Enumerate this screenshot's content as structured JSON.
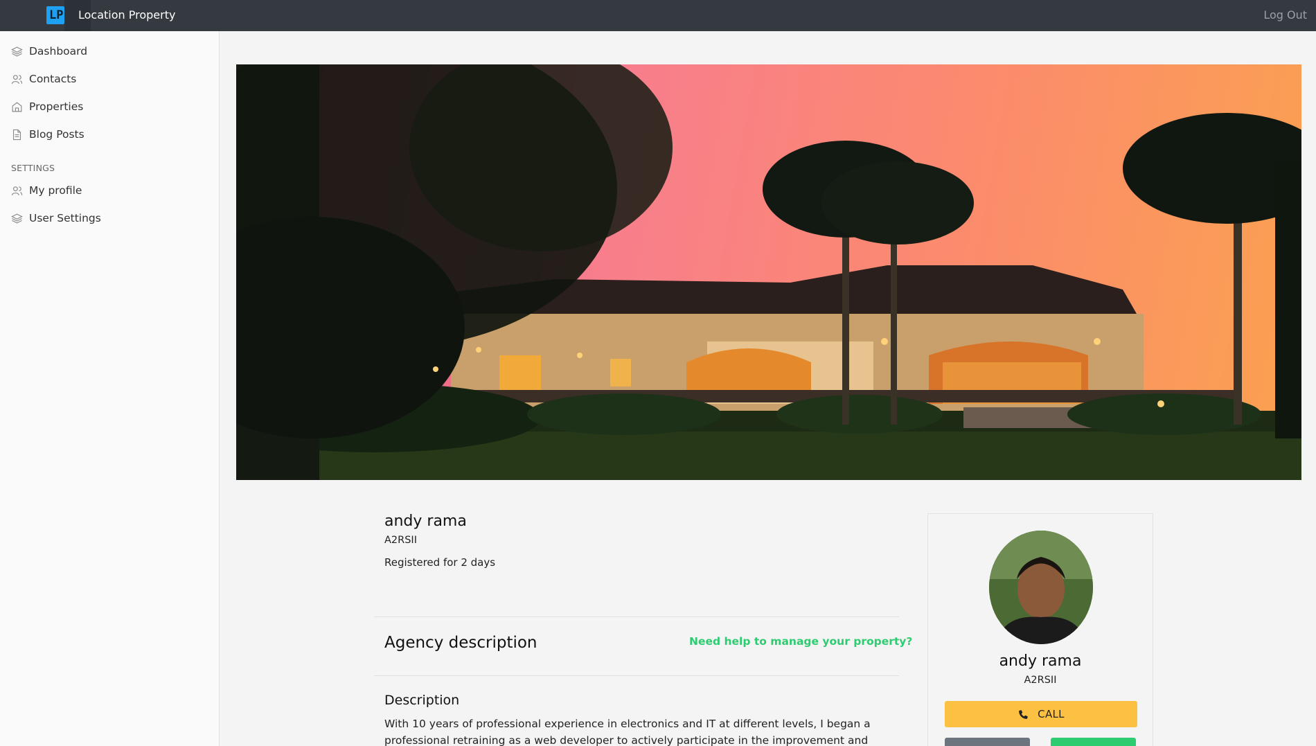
{
  "app": {
    "logo_text": "LP",
    "title": "Location Property",
    "logout_label": "Log Out"
  },
  "sidebar": {
    "items": [
      {
        "label": "Dashboard",
        "icon": "layers-icon"
      },
      {
        "label": "Contacts",
        "icon": "users-icon"
      },
      {
        "label": "Properties",
        "icon": "home-icon"
      },
      {
        "label": "Blog Posts",
        "icon": "file-icon"
      }
    ],
    "settings_label": "SETTINGS",
    "settings_items": [
      {
        "label": "My profile",
        "icon": "users-icon"
      },
      {
        "label": "User Settings",
        "icon": "layers-icon"
      }
    ]
  },
  "hero": {
    "alt": "house at sunset",
    "colors": {
      "sky_left": "#d84a7c",
      "sky_right": "#fba24f"
    }
  },
  "profile": {
    "name": "andy rama",
    "code": "A2RSII",
    "registered": "Registered for 2 days"
  },
  "agency": {
    "title": "Agency description",
    "help_link": "Need help to manage your property?",
    "description_title": "Description",
    "description_text": "With 10 years of professional experience in electronics and IT at different levels, I began a professional retraining as a web developer to actively participate in the improvement and"
  },
  "card": {
    "name": "andy rama",
    "code": "A2RSII",
    "call_label": "CALL",
    "call_icon": "phone-icon",
    "colors": {
      "call": "#fcc042",
      "secondary": "#6c757d",
      "accent": "#2ecc71"
    }
  }
}
